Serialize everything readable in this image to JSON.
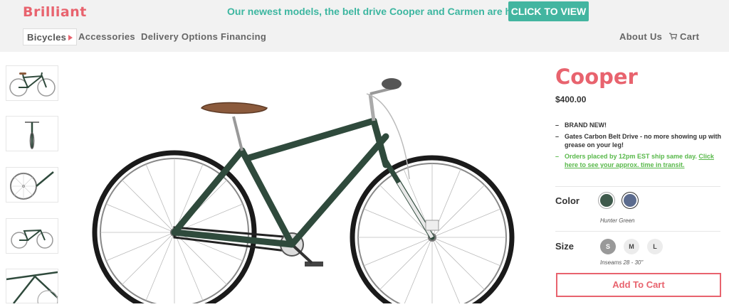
{
  "header": {
    "logo": "Brilliant",
    "promo_text": "Our newest models, the belt drive Cooper and Carmen are here!.",
    "cta_label": "CLICK TO VIEW"
  },
  "nav": {
    "items": [
      "Bicycles",
      "Accessories",
      "Delivery Options",
      "Financing"
    ],
    "right": [
      "About Us",
      "Cart"
    ]
  },
  "product": {
    "name": "Cooper",
    "price": "$400.00",
    "features": [
      "BRAND NEW!",
      "Gates Carbon Belt Drive - no more showing up with grease on your leg!"
    ],
    "shipping_note": "Orders placed by 12pm EST ship same day.",
    "shipping_link": "Click here to see your approx. time in transit.",
    "color_label": "Color",
    "colors": [
      "#3f5a4c",
      "#5b6b8e"
    ],
    "color_selected_name": "Hunter Green",
    "size_label": "Size",
    "sizes": [
      "S",
      "M",
      "L"
    ],
    "size_caption": "Inseams 28 - 30\"",
    "add_to_cart": "Add To Cart"
  },
  "colors": {
    "brand": "#e8636e",
    "teal": "#43b5a0",
    "frame": "#2f4a3c",
    "link_green": "#58b84a"
  }
}
